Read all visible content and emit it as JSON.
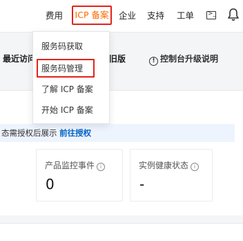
{
  "topnav": {
    "items": [
      "费用",
      "ICP 备案",
      "企业",
      "支持",
      "工单"
    ],
    "active_item": "ICP 备案",
    "active_color": "#ff6a00",
    "highlight_border_color": "#e2231a",
    "icons": [
      "terminal-icon",
      "bell-icon"
    ]
  },
  "dropdown": {
    "items": [
      "服务码获取",
      "服务码管理",
      "了解 ICP 备案",
      "开始 ICP 备案"
    ],
    "highlighted_item": "服务码管理"
  },
  "secondary_bar": {
    "recent_visits": "最近访问",
    "version_suffix": "旧版",
    "upgrade_notice": "控制台升级说明"
  },
  "auth_banner": {
    "text": "态需授权后展示",
    "link": "前往授权"
  },
  "metrics": [
    {
      "label": "产品监控事件",
      "value": "0"
    },
    {
      "label": "实例健康状态",
      "value": "-"
    }
  ],
  "colors": {
    "link": "#0064c8",
    "banner_bg": "#eef4fd",
    "page_bg": "#f4f5f7"
  }
}
